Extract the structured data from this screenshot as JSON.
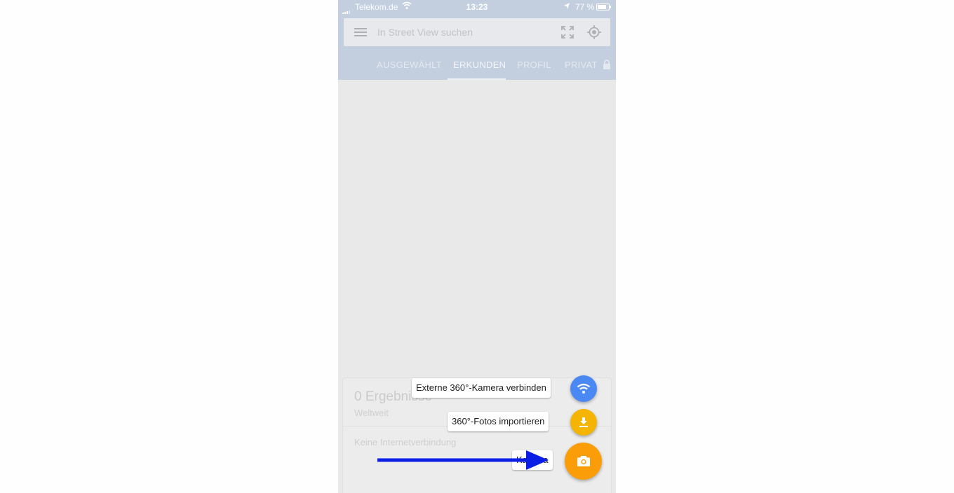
{
  "status_bar": {
    "carrier": "Telekom.de",
    "time": "13:23",
    "battery": "77 %"
  },
  "search": {
    "placeholder": "In Street View suchen"
  },
  "tabs": [
    {
      "label": "AUSGEWÄHLT"
    },
    {
      "label": "ERKUNDEN",
      "selected": true
    },
    {
      "label": "PROFIL"
    },
    {
      "label": "PRIVAT"
    }
  ],
  "results": {
    "count_label": "0 Ergebnisse",
    "scope": "Weltweit",
    "status": "Keine Internetverbindung"
  },
  "fab_menu": {
    "connect_label": "Externe 360°-Kamera verbinden",
    "import_label": "360°-Fotos importieren",
    "camera_label": "Kamera"
  },
  "colors": {
    "header_dim": "#c3cedf",
    "fab_camera": "#fb9d08",
    "fab_import": "#f4b400",
    "fab_connect": "#4a89f3",
    "annotation_arrow": "#0a1ee6"
  },
  "icons": {
    "menu": "hamburger-menu-icon",
    "fullscreen": "expand-icon",
    "location": "gps-target-icon",
    "private": "lock-icon",
    "connect": "wifi-icon",
    "import": "download-icon",
    "camera": "camera-icon"
  }
}
